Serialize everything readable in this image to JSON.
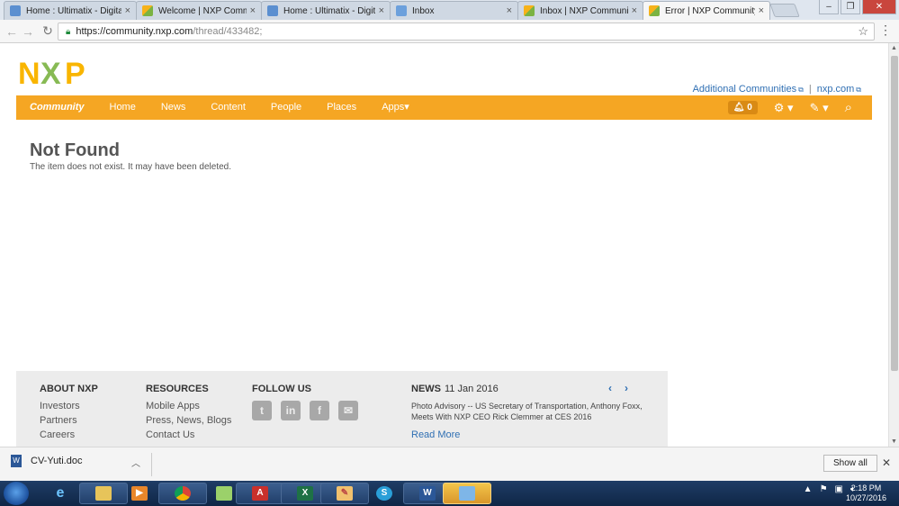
{
  "browser": {
    "tabs": [
      {
        "title": "Home : Ultimatix - Digita",
        "favicon": "fav-blue",
        "active": false
      },
      {
        "title": "Welcome | NXP Commun",
        "favicon": "fav-yellow",
        "active": false
      },
      {
        "title": "Home : Ultimatix - Digita",
        "favicon": "fav-blue",
        "active": false
      },
      {
        "title": "Inbox",
        "favicon": "fav-gmail",
        "active": false
      },
      {
        "title": "Inbox | NXP Community",
        "favicon": "fav-yellow",
        "active": false
      },
      {
        "title": "Error | NXP Community",
        "favicon": "fav-yellow",
        "active": true
      }
    ],
    "tab_close": "×",
    "url_host": "https://community.nxp.com",
    "url_path": "/thread/433482;",
    "window_controls": {
      "minimize": "–",
      "maximize": "❐",
      "close": "✕"
    }
  },
  "header": {
    "additional_communities": "Additional Communities",
    "nxp_com": "nxp.com",
    "separator": "|"
  },
  "nav": {
    "items": [
      "Community",
      "Home",
      "News",
      "Content",
      "People",
      "Places",
      "Apps"
    ],
    "apps_caret": "▾",
    "notification_count": "0"
  },
  "main": {
    "title": "Not Found",
    "message": "The item does not exist. It may have been deleted."
  },
  "footer": {
    "about": {
      "heading": "ABOUT NXP",
      "links": [
        "Investors",
        "Partners",
        "Careers"
      ]
    },
    "resources": {
      "heading": "RESOURCES",
      "links": [
        "Mobile Apps",
        "Press, News, Blogs",
        "Contact Us"
      ]
    },
    "follow": {
      "heading": "FOLLOW US",
      "icons": [
        "twitter-icon",
        "linkedin-icon",
        "facebook-icon",
        "email-icon"
      ]
    },
    "news": {
      "heading": "NEWS",
      "date": "11 Jan 2016",
      "text": "Photo Advisory -- US Secretary of Transportation, Anthony Foxx, Meets With NXP CEO Rick Clemmer at CES 2016",
      "read_more": "Read More"
    }
  },
  "downloads": {
    "file_name": "CV-Yuti.doc",
    "show_all": "Show all"
  },
  "taskbar": {
    "time": "2:18 PM",
    "date": "10/27/2016"
  },
  "colors": {
    "nav_orange": "#f5a623",
    "link_blue": "#2f6fb3",
    "nxp_yellow": "#f9b500",
    "nxp_green": "#7bb342"
  }
}
